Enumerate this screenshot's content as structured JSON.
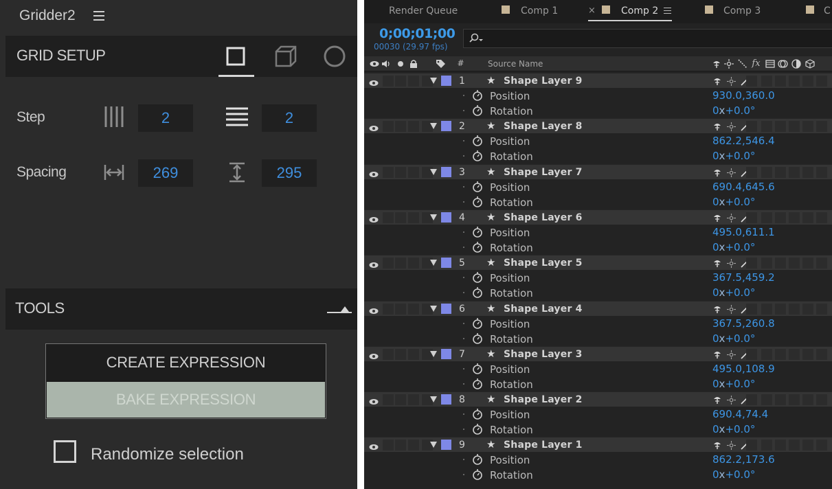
{
  "gridder": {
    "title": "Gridder2",
    "grid_setup_label": "GRID SETUP",
    "modes": [
      "square-icon",
      "cube-icon",
      "circle-icon"
    ],
    "step_label": "Step",
    "step_columns": "2",
    "step_rows": "2",
    "spacing_label": "Spacing",
    "spacing_horizontal": "269",
    "spacing_vertical": "295",
    "tools_label": "TOOLS",
    "create_expression_label": "CREATE EXPRESSION",
    "bake_expression_label": "BAKE EXPRESSION",
    "randomize_label": "Randomize selection"
  },
  "timeline": {
    "tabs": [
      {
        "label": "Render Queue"
      },
      {
        "label": "Comp 1"
      },
      {
        "label": "Comp 2"
      },
      {
        "label": "Comp 3"
      },
      {
        "label": "C"
      }
    ],
    "close_glyph": "×",
    "timecode": "0;00;01;00",
    "frame_info": "00030 (29.97 fps)",
    "hash": "#",
    "source_name_header": "Source Name",
    "prop_position_label": "Position",
    "prop_rotation_label": "Rotation",
    "layers": [
      {
        "num": "1",
        "name": "Shape Layer 9",
        "position": "930.0,360.0",
        "rot_turns": "0",
        "rot_x": "x",
        "rot_deg": "+0.0°"
      },
      {
        "num": "2",
        "name": "Shape Layer 8",
        "position": "862.2,546.4",
        "rot_turns": "0",
        "rot_x": "x",
        "rot_deg": "+0.0°"
      },
      {
        "num": "3",
        "name": "Shape Layer 7",
        "position": "690.4,645.6",
        "rot_turns": "0",
        "rot_x": "x",
        "rot_deg": "+0.0°"
      },
      {
        "num": "4",
        "name": "Shape Layer 6",
        "position": "495.0,611.1",
        "rot_turns": "0",
        "rot_x": "x",
        "rot_deg": "+0.0°"
      },
      {
        "num": "5",
        "name": "Shape Layer 5",
        "position": "367.5,459.2",
        "rot_turns": "0",
        "rot_x": "x",
        "rot_deg": "+0.0°"
      },
      {
        "num": "6",
        "name": "Shape Layer 4",
        "position": "367.5,260.8",
        "rot_turns": "0",
        "rot_x": "x",
        "rot_deg": "+0.0°"
      },
      {
        "num": "7",
        "name": "Shape Layer 3",
        "position": "495.0,108.9",
        "rot_turns": "0",
        "rot_x": "x",
        "rot_deg": "+0.0°"
      },
      {
        "num": "8",
        "name": "Shape Layer 2",
        "position": "690.4,74.4",
        "rot_turns": "0",
        "rot_x": "x",
        "rot_deg": "+0.0°"
      },
      {
        "num": "9",
        "name": "Shape Layer 1",
        "position": "862.2,173.6",
        "rot_turns": "0",
        "rot_x": "x",
        "rot_deg": "+0.0°"
      }
    ],
    "colors": {
      "label_swatch": "#7e88e6",
      "tab_swatch": "#c7b596",
      "value_blue": "#3d96e6"
    }
  }
}
